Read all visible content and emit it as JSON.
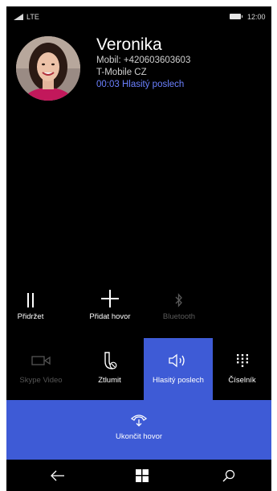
{
  "status": {
    "network": "LTE",
    "time": "12:00"
  },
  "caller": {
    "name": "Veronika",
    "number": "Mobil: +420603603603",
    "carrier": "T-Mobile CZ",
    "duration": "00:03",
    "mode": "Hlasitý poslech"
  },
  "actions_row1": {
    "hold": "Přidržet",
    "add_call": "Přidat hovor",
    "bluetooth": "Bluetooth"
  },
  "actions_row2": {
    "skype_video": "Skype Video",
    "mute": "Ztlumit",
    "speaker": "Hlasitý poslech",
    "keypad": "Číselník"
  },
  "end_call": {
    "label": "Ukončit hovor"
  },
  "colors": {
    "accent": "#3e5bd6",
    "link": "#6b80ff",
    "background": "#000000"
  },
  "icons": [
    "signal-icon",
    "battery-icon",
    "pause-icon",
    "plus-icon",
    "bluetooth-icon",
    "video-icon",
    "mute-icon",
    "speaker-icon",
    "keypad-icon",
    "end-call-icon",
    "back-icon",
    "windows-icon",
    "search-icon"
  ]
}
